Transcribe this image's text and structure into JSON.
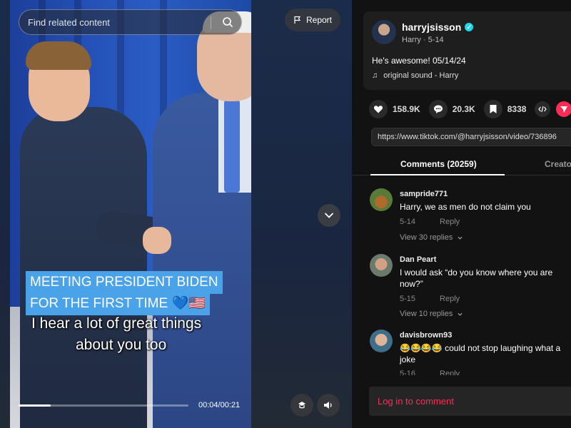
{
  "search": {
    "placeholder": "Find related content"
  },
  "report": {
    "label": "Report"
  },
  "video": {
    "caption_line1": "MEETING PRESIDENT BIDEN",
    "caption_line2": "FOR THE FIRST TIME 💙🇺🇸",
    "subtitle_line1": "I hear a lot of great things",
    "subtitle_line2": "about you too",
    "time": "00:04/00:21",
    "progress": 0.19
  },
  "post": {
    "username": "harryjsisson",
    "display_name": "Harry",
    "date": "5-14",
    "sub_info": "Harry · 5-14",
    "description": "He's awesome! 05/14/24",
    "sound": "original sound - Harry"
  },
  "actions": {
    "likes": "158.9K",
    "comments": "20.3K",
    "saves": "8338"
  },
  "url": "https://www.tiktok.com/@harryjsisson/video/736896",
  "tabs": {
    "comments": "Comments (20259)",
    "creator": "Creator"
  },
  "comments": [
    {
      "user": "sampride771",
      "text": "Harry, we as men do not claim you",
      "date": "5-14",
      "reply": "Reply",
      "replies": "View 30 replies"
    },
    {
      "user": "Dan Peart",
      "text": "I would ask “do you know where you are now?”",
      "date": "5-15",
      "reply": "Reply",
      "replies": "View 10 replies"
    },
    {
      "user": "davisbrown93",
      "text": "😂😂😂😂 could not stop laughing what a joke",
      "date": "5-16",
      "reply": "Reply"
    }
  ],
  "login": {
    "label": "Log in to comment"
  },
  "colors": {
    "accent": "#fe2c55",
    "verified": "#20d5ec",
    "caption_bg": "#4aa2e8"
  }
}
